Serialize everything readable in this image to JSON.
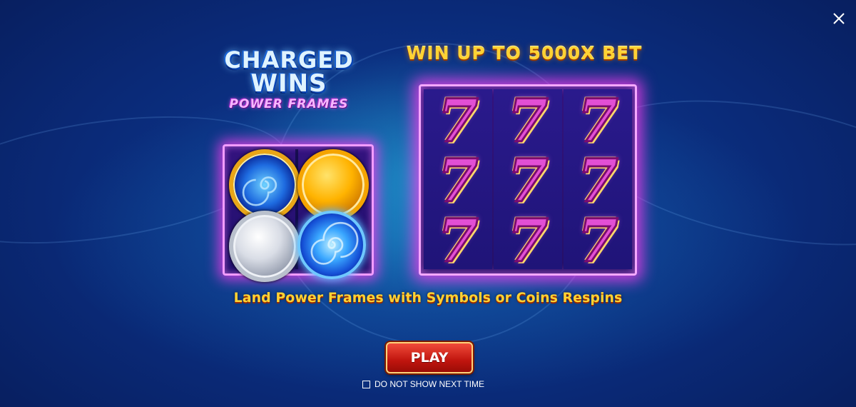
{
  "window": {
    "close_icon": "close-icon"
  },
  "logo": {
    "line1": "CHARGED",
    "line2": "WINS",
    "line3": "POWER FRAMES"
  },
  "headline": "WIN UP TO 5000X BET",
  "coins": [
    {
      "name": "blue-swirl-gold-coin"
    },
    {
      "name": "gold-coin"
    },
    {
      "name": "silver-coin"
    },
    {
      "name": "blue-vortex-coin"
    }
  ],
  "reels": {
    "columns": 3,
    "rows": 3,
    "symbol": "7"
  },
  "tagline": "Land Power Frames with Symbols or Coins Respins",
  "play_button": {
    "label": "PLAY"
  },
  "dont_show": {
    "label": "DO NOT SHOW NEXT TIME",
    "checked": false
  },
  "colors": {
    "headline": "#ffd233",
    "frame_glow": "#ff3cf0",
    "play_button": "#c0150e"
  }
}
